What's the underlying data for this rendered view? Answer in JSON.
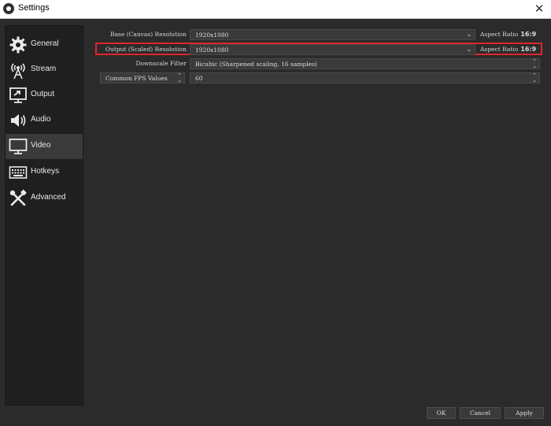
{
  "window": {
    "title": "Settings",
    "close_glyph": "✕"
  },
  "sidebar": {
    "items": [
      {
        "label": "General",
        "icon": "gear-icon"
      },
      {
        "label": "Stream",
        "icon": "broadcast-antenna-icon"
      },
      {
        "label": "Output",
        "icon": "monitor-output-icon"
      },
      {
        "label": "Audio",
        "icon": "speaker-icon"
      },
      {
        "label": "Video",
        "icon": "monitor-icon"
      },
      {
        "label": "Hotkeys",
        "icon": "keyboard-icon"
      },
      {
        "label": "Advanced",
        "icon": "tools-icon"
      }
    ],
    "active_index": 4
  },
  "video": {
    "base_resolution": {
      "label": "Base (Canvas) Resolution",
      "value": "1920x1080",
      "aspect_label": "Aspect Ratio",
      "aspect_value": "16:9"
    },
    "output_resolution": {
      "label": "Output (Scaled) Resolution",
      "value": "1920x1080",
      "aspect_label": "Aspect Ratio",
      "aspect_value": "16:9"
    },
    "downscale_filter": {
      "label": "Downscale Filter",
      "value": "Bicubic (Sharpened scaling, 16 samples)"
    },
    "fps": {
      "type_label": "Common FPS Values",
      "value": "60"
    }
  },
  "buttons": {
    "ok": "OK",
    "cancel": "Cancel",
    "apply": "Apply"
  },
  "colors": {
    "background": "#2b2b2b",
    "sidebar": "#1f1f1f",
    "highlight": "#e0252a"
  }
}
